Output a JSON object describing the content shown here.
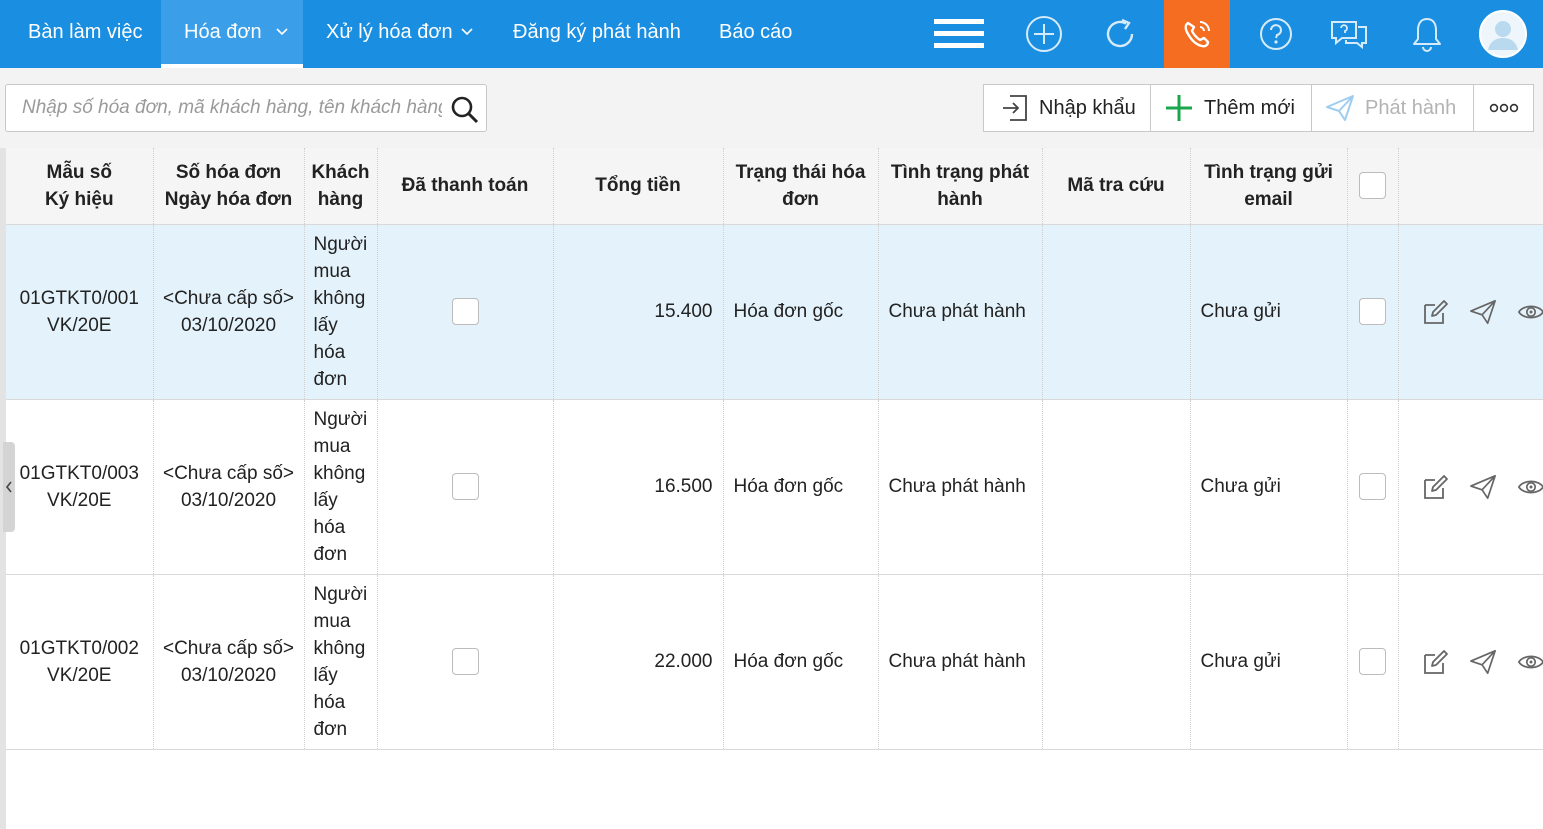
{
  "nav": {
    "items": [
      {
        "label": "Bàn làm việc"
      },
      {
        "label": "Hóa đơn"
      },
      {
        "label": "Xử lý hóa đơn"
      },
      {
        "label": "Đăng ký phát hành"
      },
      {
        "label": "Báo cáo"
      }
    ],
    "active": "Hóa đơn",
    "icons": [
      "hamburger-menu-icon",
      "add-circle-icon",
      "refresh-icon",
      "phone-support-icon",
      "help-icon",
      "chat-icon",
      "bell-icon",
      "user-avatar-icon"
    ]
  },
  "colors": {
    "nav_bg": "#1a8ee0",
    "phone_bg": "#f46d20",
    "selected_row": "#e4f3fb",
    "accent_green": "#1aa64a"
  },
  "search": {
    "placeholder": "Nhập số hóa đơn, mã khách hàng, tên khách hàng, tổng tiền"
  },
  "toolbar": {
    "import_label": "Nhập khẩu",
    "add_label": "Thêm mới",
    "issue_label": "Phát hành"
  },
  "table": {
    "headers": {
      "template_line1": "Mẫu số",
      "template_line2": "Ký hiệu",
      "number_line1": "Số hóa đơn",
      "number_line2": "Ngày hóa đơn",
      "customer_line1": "Khách",
      "customer_line2": "hàng",
      "paid": "Đã thanh toán",
      "total": "Tổng tiền",
      "status_line1": "Trạng thái hóa",
      "status_line2": "đơn",
      "issue_line1": "Tình trạng phát",
      "issue_line2": "hành",
      "lookup": "Mã tra cứu",
      "email_line1": "Tình trạng gửi",
      "email_line2": "email"
    },
    "rows": [
      {
        "template": "01GTKT0/001",
        "series": "VK/20E",
        "number": "<Chưa cấp số>",
        "date": "03/10/2020",
        "customer": [
          "Người",
          "mua",
          "không",
          "lấy",
          "hóa",
          "đơn"
        ],
        "paid": false,
        "total": "15.400",
        "status": "Hóa đơn gốc",
        "issue": "Chưa phát hành",
        "lookup": "",
        "email": "Chưa gửi",
        "selected": false
      },
      {
        "template": "01GTKT0/003",
        "series": "VK/20E",
        "number": "<Chưa cấp số>",
        "date": "03/10/2020",
        "customer": [
          "Người",
          "mua",
          "không",
          "lấy",
          "hóa",
          "đơn"
        ],
        "paid": false,
        "total": "16.500",
        "status": "Hóa đơn gốc",
        "issue": "Chưa phát hành",
        "lookup": "",
        "email": "Chưa gửi",
        "selected": false
      },
      {
        "template": "01GTKT0/002",
        "series": "VK/20E",
        "number": "<Chưa cấp số>",
        "date": "03/10/2020",
        "customer": [
          "Người",
          "mua",
          "không",
          "lấy",
          "hóa",
          "đơn"
        ],
        "paid": false,
        "total": "22.000",
        "status": "Hóa đơn gốc",
        "issue": "Chưa phát hành",
        "lookup": "",
        "email": "Chưa gửi",
        "selected": false
      }
    ],
    "row_actions": [
      "edit-icon",
      "send-icon",
      "view-icon"
    ]
  }
}
